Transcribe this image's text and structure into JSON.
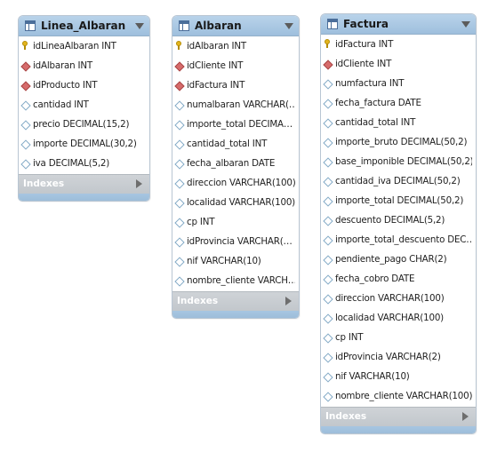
{
  "tables": {
    "linea_albaran": {
      "title": "Linea_Albaran",
      "indexes_label": "Indexes",
      "columns": [
        {
          "name": "idLineaAlbaran INT",
          "kind": "pk"
        },
        {
          "name": "idAlbaran INT",
          "kind": "fk"
        },
        {
          "name": "idProducto INT",
          "kind": "fk"
        },
        {
          "name": "cantidad INT",
          "kind": "attr"
        },
        {
          "name": "precio DECIMAL(15,2)",
          "kind": "attr"
        },
        {
          "name": "importe DECIMAL(30,2)",
          "kind": "attr"
        },
        {
          "name": "iva DECIMAL(5,2)",
          "kind": "attr"
        }
      ]
    },
    "albaran": {
      "title": "Albaran",
      "indexes_label": "Indexes",
      "columns": [
        {
          "name": "idAlbaran INT",
          "kind": "pk"
        },
        {
          "name": "idCliente INT",
          "kind": "fk"
        },
        {
          "name": "idFactura INT",
          "kind": "fk"
        },
        {
          "name": "numalbaran VARCHAR(…",
          "kind": "attr"
        },
        {
          "name": "importe_total DECIMA…",
          "kind": "attr"
        },
        {
          "name": "cantidad_total INT",
          "kind": "attr"
        },
        {
          "name": "fecha_albaran DATE",
          "kind": "attr"
        },
        {
          "name": "direccion VARCHAR(100)",
          "kind": "attr"
        },
        {
          "name": "localidad VARCHAR(100)",
          "kind": "attr"
        },
        {
          "name": "cp INT",
          "kind": "attr"
        },
        {
          "name": "idProvincia VARCHAR(…",
          "kind": "attr"
        },
        {
          "name": "nif VARCHAR(10)",
          "kind": "attr"
        },
        {
          "name": "nombre_cliente VARCH…",
          "kind": "attr"
        }
      ]
    },
    "factura": {
      "title": "Factura",
      "indexes_label": "Indexes",
      "columns": [
        {
          "name": "idFactura INT",
          "kind": "pk"
        },
        {
          "name": "idCliente INT",
          "kind": "fk"
        },
        {
          "name": "numfactura INT",
          "kind": "attr"
        },
        {
          "name": "fecha_factura DATE",
          "kind": "attr"
        },
        {
          "name": "cantidad_total INT",
          "kind": "attr"
        },
        {
          "name": "importe_bruto DECIMAL(50,2)",
          "kind": "attr"
        },
        {
          "name": "base_imponible DECIMAL(50,2)",
          "kind": "attr"
        },
        {
          "name": "cantidad_iva DECIMAL(50,2)",
          "kind": "attr"
        },
        {
          "name": "importe_total DECIMAL(50,2)",
          "kind": "attr"
        },
        {
          "name": "descuento DECIMAL(5,2)",
          "kind": "attr"
        },
        {
          "name": "importe_total_descuento DEC…",
          "kind": "attr"
        },
        {
          "name": "pendiente_pago CHAR(2)",
          "kind": "attr"
        },
        {
          "name": "fecha_cobro DATE",
          "kind": "attr"
        },
        {
          "name": "direccion VARCHAR(100)",
          "kind": "attr"
        },
        {
          "name": "localidad VARCHAR(100)",
          "kind": "attr"
        },
        {
          "name": "cp INT",
          "kind": "attr"
        },
        {
          "name": "idProvincia VARCHAR(2)",
          "kind": "attr"
        },
        {
          "name": "nif VARCHAR(10)",
          "kind": "attr"
        },
        {
          "name": "nombre_cliente VARCHAR(100)",
          "kind": "attr"
        }
      ]
    }
  },
  "icons": {
    "table": "table-icon",
    "pk": "primary-key-icon",
    "fk": "foreign-key-icon",
    "attr": "column-diamond-icon",
    "collapse": "chevron-down-icon",
    "expand": "chevron-right-icon"
  },
  "colors": {
    "header": "#a9c8e6",
    "footer": "#a1c0dc",
    "fk": "#d66b6b",
    "pk": "#e3b51d",
    "attr_outline": "#83aac6",
    "indexes_bar": "#c8cdd2"
  }
}
